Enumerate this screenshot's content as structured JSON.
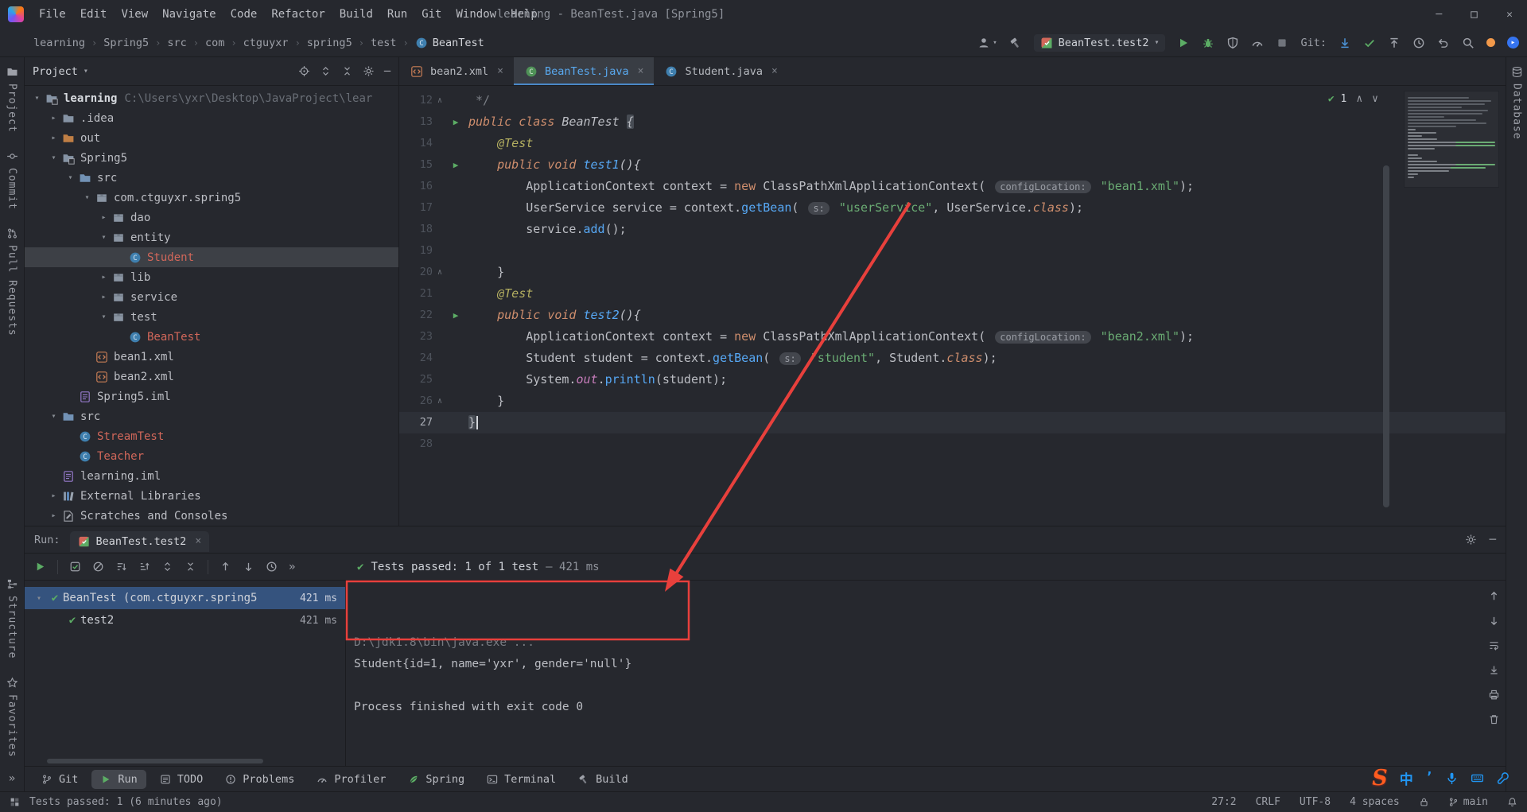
{
  "window": {
    "title": "learning - BeanTest.java [Spring5]"
  },
  "menu_bar": {
    "menus": [
      "File",
      "Edit",
      "View",
      "Navigate",
      "Code",
      "Refactor",
      "Build",
      "Run",
      "Git",
      "Window",
      "Help"
    ]
  },
  "breadcrumbs": {
    "items": [
      "learning",
      "Spring5",
      "src",
      "com",
      "ctguyxr",
      "spring5",
      "test",
      "BeanTest"
    ]
  },
  "toolbar": {
    "run_config": "BeanTest.test2",
    "git_label": "Git:"
  },
  "left_stripe": {
    "top": [
      {
        "label": "Project",
        "icon": "project"
      },
      {
        "label": "Commit",
        "icon": "commit"
      },
      {
        "label": "Pull Requests",
        "icon": "pull-requests"
      }
    ],
    "bottom": [
      {
        "label": "Structure",
        "icon": "structure"
      },
      {
        "label": "Favorites",
        "icon": "favorites"
      }
    ],
    "more": "»"
  },
  "right_stripe": {
    "top": [
      {
        "label": "Database",
        "icon": "database"
      }
    ]
  },
  "project_panel": {
    "title": "Project",
    "tree": [
      {
        "depth": 0,
        "chevron": "v",
        "icon": "module",
        "label": "learning",
        "bold": true,
        "path": "C:\\Users\\yxr\\Desktop\\JavaProject\\lear"
      },
      {
        "depth": 1,
        "chevron": ">",
        "icon": "folder",
        "label": ".idea"
      },
      {
        "depth": 1,
        "chevron": ">",
        "icon": "folderx",
        "label": "out"
      },
      {
        "depth": 1,
        "chevron": "v",
        "icon": "module",
        "label": "Spring5"
      },
      {
        "depth": 2,
        "chevron": "v",
        "icon": "foldersrc",
        "label": "src"
      },
      {
        "depth": 3,
        "chevron": "v",
        "icon": "package",
        "label": "com.ctguyxr.spring5"
      },
      {
        "depth": 4,
        "chevron": ">",
        "icon": "package",
        "label": "dao"
      },
      {
        "depth": 4,
        "chevron": "v",
        "icon": "package",
        "label": "entity"
      },
      {
        "depth": 5,
        "chevron": "",
        "icon": "classicon",
        "label": "Student",
        "vcs": true,
        "selected": true
      },
      {
        "depth": 4,
        "chevron": ">",
        "icon": "package",
        "label": "lib"
      },
      {
        "depth": 4,
        "chevron": ">",
        "icon": "package",
        "label": "service"
      },
      {
        "depth": 4,
        "chevron": "v",
        "icon": "package",
        "label": "test"
      },
      {
        "depth": 5,
        "chevron": "",
        "icon": "classicon",
        "label": "BeanTest",
        "vcs": true
      },
      {
        "depth": 3,
        "chevron": "",
        "icon": "xmlfile",
        "label": "bean1.xml"
      },
      {
        "depth": 3,
        "chevron": "",
        "icon": "xmlfile",
        "label": "bean2.xml"
      },
      {
        "depth": 2,
        "chevron": "",
        "icon": "imlfile",
        "label": "Spring5.iml"
      },
      {
        "depth": 1,
        "chevron": "v",
        "icon": "foldersrc",
        "label": "src"
      },
      {
        "depth": 2,
        "chevron": "",
        "icon": "classicon",
        "label": "StreamTest",
        "vcs": true
      },
      {
        "depth": 2,
        "chevron": "",
        "icon": "classicon",
        "label": "Teacher",
        "vcs": true
      },
      {
        "depth": 1,
        "chevron": "",
        "icon": "imlfile",
        "label": "learning.iml"
      },
      {
        "depth": 1,
        "chevron": ">",
        "icon": "books",
        "label": "External Libraries"
      },
      {
        "depth": 1,
        "chevron": ">",
        "icon": "scratch",
        "label": "Scratches and Consoles"
      }
    ]
  },
  "editor": {
    "tabs": [
      {
        "label": "bean2.xml",
        "icon": "xmlfile",
        "active": false
      },
      {
        "label": "BeanTest.java",
        "icon": "testclass",
        "active": true
      },
      {
        "label": "Student.java",
        "icon": "classicon",
        "active": false
      }
    ],
    "inspection_count": "1",
    "lines": [
      {
        "n": "12",
        "fold": true,
        "seg": [
          [
            "cmt",
            " */"
          ]
        ]
      },
      {
        "n": "13",
        "run": true,
        "it": true,
        "seg": [
          [
            "kw",
            "public class "
          ],
          [
            "txt",
            "BeanTest "
          ],
          [
            "brh",
            "{"
          ]
        ]
      },
      {
        "n": "14",
        "it": true,
        "seg": [
          [
            "ann",
            "    @Test"
          ]
        ]
      },
      {
        "n": "15",
        "run": true,
        "it": true,
        "seg": [
          [
            "kw",
            "    public void "
          ],
          [
            "meth",
            "test1"
          ],
          [
            "txt",
            "(){"
          ]
        ]
      },
      {
        "n": "16",
        "seg": [
          [
            "txt",
            "        ApplicationContext context = "
          ],
          [
            "kw",
            "new"
          ],
          [
            "txt",
            " ClassPathXmlApplicationContext( "
          ],
          [
            "hint",
            "configLocation:"
          ],
          [
            "str",
            " \"bean1.xml\""
          ],
          [
            "txt",
            ");"
          ]
        ]
      },
      {
        "n": "17",
        "seg": [
          [
            "txt",
            "        UserService service = context."
          ],
          [
            "meth",
            "getBean"
          ],
          [
            "txt",
            "( "
          ],
          [
            "hint",
            "s:"
          ],
          [
            "str",
            " \"userService\""
          ],
          [
            "txt",
            ", UserService."
          ],
          [
            "kwi",
            "class"
          ],
          [
            "txt",
            ");"
          ]
        ]
      },
      {
        "n": "18",
        "seg": [
          [
            "txt",
            "        service."
          ],
          [
            "meth",
            "add"
          ],
          [
            "txt",
            "();"
          ]
        ]
      },
      {
        "n": "19",
        "seg": []
      },
      {
        "n": "20",
        "fold": true,
        "seg": [
          [
            "txt",
            "    }"
          ]
        ]
      },
      {
        "n": "21",
        "it": true,
        "seg": [
          [
            "ann",
            "    @Test"
          ]
        ]
      },
      {
        "n": "22",
        "run": true,
        "it": true,
        "seg": [
          [
            "kw",
            "    public void "
          ],
          [
            "meth",
            "test2"
          ],
          [
            "txt",
            "(){"
          ]
        ]
      },
      {
        "n": "23",
        "seg": [
          [
            "txt",
            "        ApplicationContext context = "
          ],
          [
            "kw",
            "new"
          ],
          [
            "txt",
            " ClassPathXmlApplicationContext( "
          ],
          [
            "hint",
            "configLocation:"
          ],
          [
            "str",
            " \"bean2.xml\""
          ],
          [
            "txt",
            ");"
          ]
        ]
      },
      {
        "n": "24",
        "seg": [
          [
            "txt",
            "        Student student = context."
          ],
          [
            "meth",
            "getBean"
          ],
          [
            "txt",
            "( "
          ],
          [
            "hint",
            "s:"
          ],
          [
            "str",
            " \"student\""
          ],
          [
            "txt",
            ", Student."
          ],
          [
            "kwi",
            "class"
          ],
          [
            "txt",
            ");"
          ]
        ]
      },
      {
        "n": "25",
        "seg": [
          [
            "txt",
            "        System."
          ],
          [
            "fld",
            "out"
          ],
          [
            "txt",
            "."
          ],
          [
            "meth",
            "println"
          ],
          [
            "txt",
            "(student);"
          ]
        ]
      },
      {
        "n": "26",
        "fold": true,
        "seg": [
          [
            "txt",
            "    }"
          ]
        ]
      },
      {
        "n": "27",
        "current": true,
        "seg": [
          [
            "brh",
            "}"
          ],
          [
            "caret",
            ""
          ]
        ]
      },
      {
        "n": "28",
        "seg": []
      }
    ]
  },
  "run_panel": {
    "label": "Run:",
    "tab": "BeanTest.test2",
    "toolbar_icons": [
      "rerun",
      "show-passed",
      "ignore",
      "sort-desc",
      "sort-asc",
      "expand-all",
      "collapse-all",
      "previous",
      "next",
      "history",
      "more"
    ],
    "summary": {
      "text": "Tests passed: 1 of 1 test",
      "time": "– 421 ms"
    },
    "tree": [
      {
        "depth": 0,
        "chevron": "v",
        "label": "BeanTest (com.ctguyxr.spring5",
        "time": "421 ms",
        "selected": true
      },
      {
        "depth": 1,
        "chevron": "",
        "label": "test2",
        "time": "421 ms"
      }
    ],
    "console": [
      {
        "text": "D:\\jdk1.8\\bin\\java.exe ...",
        "style": "dim"
      },
      {
        "text": "Student{id=1, name='yxr', gender='null'}",
        "style": "normal"
      },
      {
        "text": "",
        "style": "normal"
      },
      {
        "text": "Process finished with exit code 0",
        "style": "normal"
      }
    ],
    "console_tools": [
      "up",
      "down",
      "softwrap",
      "scrollend",
      "print",
      "clear"
    ]
  },
  "bottom_bar": {
    "items": [
      {
        "label": "Git",
        "icon": "branch",
        "active": false
      },
      {
        "label": "Run",
        "icon": "playi",
        "active": true
      },
      {
        "label": "TODO",
        "icon": "todo",
        "active": false
      },
      {
        "label": "Problems",
        "icon": "problems",
        "active": false
      },
      {
        "label": "Profiler",
        "icon": "gauge",
        "active": false
      },
      {
        "label": "Spring",
        "icon": "leaf",
        "active": false
      },
      {
        "label": "Terminal",
        "icon": "terminal",
        "active": false
      },
      {
        "label": "Build",
        "icon": "hammer",
        "active": false
      }
    ]
  },
  "status_bar": {
    "message": "Tests passed: 1 (6 minutes ago)",
    "caret": "27:2",
    "line_sep": "CRLF",
    "encoding": "UTF-8",
    "indent": "4 spaces",
    "branch": "main"
  },
  "ime": {
    "logo": "S",
    "text_items": [
      "中",
      "’"
    ]
  }
}
